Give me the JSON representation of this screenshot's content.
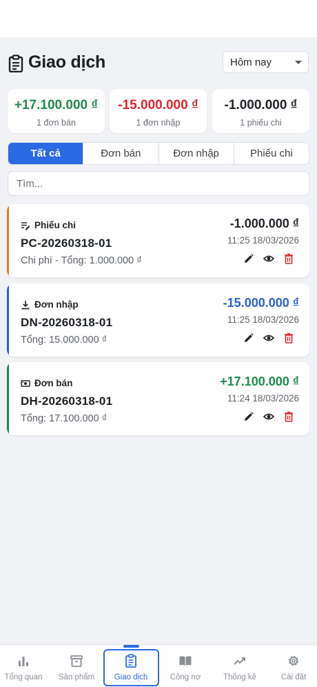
{
  "page": {
    "title": "Giao dịch"
  },
  "filter": {
    "selected": "Hôm nay"
  },
  "summary": [
    {
      "amount": "+17.100.000 ₫",
      "sub": "1 đơn bán",
      "color": "#1d8a4f"
    },
    {
      "amount": "-15.000.000 ₫",
      "sub": "1 đơn nhập",
      "color": "#d9282f"
    },
    {
      "amount": "-1.000.000 ₫",
      "sub": "1 phiếu chi",
      "color": "#1f2328"
    }
  ],
  "tabs": [
    {
      "label": "Tất cả",
      "active": true
    },
    {
      "label": "Đơn bán",
      "active": false
    },
    {
      "label": "Đơn nhập",
      "active": false
    },
    {
      "label": "Phiếu chi",
      "active": false
    }
  ],
  "search": {
    "placeholder": "Tìm..."
  },
  "transactions": [
    {
      "type": "Phiếu chi",
      "icon": "expense-icon",
      "code": "PC-20260318-01",
      "detail": "Chi phí - Tổng: 1.000.000 ₫",
      "amount": "-1.000.000 ₫",
      "time": "11:25 18/03/2026",
      "accent": "#e07b1a",
      "amount_color": "#1f2328"
    },
    {
      "type": "Đơn nhập",
      "icon": "import-icon",
      "code": "DN-20260318-01",
      "detail": "Tổng: 15.000.000 ₫",
      "amount": "-15.000.000 ₫",
      "time": "11:25 18/03/2026",
      "accent": "#2a62c9",
      "amount_color": "#2a62c9"
    },
    {
      "type": "Đơn bán",
      "icon": "cash-icon",
      "code": "DH-20260318-01",
      "detail": "Tổng: 17.100.000 ₫",
      "amount": "+17.100.000 ₫",
      "time": "11:24 18/03/2026",
      "accent": "#1d8a4f",
      "amount_color": "#1d8a4f"
    }
  ],
  "nav": [
    {
      "label": "Tổng quan",
      "icon": "bar-chart-icon",
      "active": false
    },
    {
      "label": "Sản phẩm",
      "icon": "archive-box-icon",
      "active": false
    },
    {
      "label": "Giao dịch",
      "icon": "clipboard-icon",
      "active": true
    },
    {
      "label": "Công nợ",
      "icon": "open-book-icon",
      "active": false
    },
    {
      "label": "Thống kê",
      "icon": "trend-up-icon",
      "active": false
    },
    {
      "label": "Cài đặt",
      "icon": "gear-icon",
      "active": false
    }
  ],
  "colors": {
    "primary": "#2a6ae3",
    "income": "#1d8a4f",
    "expense": "#d9282f",
    "delete": "#d9282f"
  }
}
